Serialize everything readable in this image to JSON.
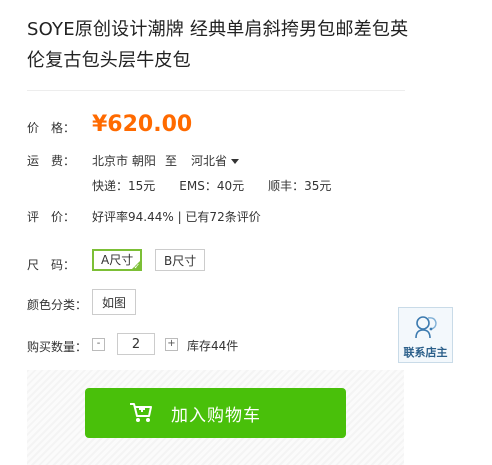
{
  "product": {
    "title": "SOYE原创设计潮牌 经典单肩斜挎男包邮差包英伦复古包头层牛皮包"
  },
  "price": {
    "label": "价　格：",
    "value": "¥620.00"
  },
  "shipping": {
    "label": "运　费：",
    "from": "北京市 朝阳",
    "to_word": "至",
    "to": "河北省",
    "rates": "快递：15元　　EMS：40元　　顺丰：35元"
  },
  "rating": {
    "label": "评　价：",
    "text": "好评率94.44% | 已有72条评价"
  },
  "size": {
    "label": "尺　码：",
    "options": [
      "A尺寸",
      "B尺寸"
    ],
    "selected": "A尺寸"
  },
  "color": {
    "label": "颜色分类：",
    "options": [
      "如图"
    ]
  },
  "quantity": {
    "label": "购买数量：",
    "minus": "-",
    "value": "2",
    "plus": "+",
    "stock": "库存44件"
  },
  "cart": {
    "button_label": "加入购物车",
    "icon": "cart-icon"
  },
  "contact": {
    "label": "联系店主",
    "icon": "customer-service-icon"
  },
  "colors": {
    "price": "#ff6a00",
    "accent_green": "#49c00a",
    "selected_border": "#7cbf36",
    "contact_text": "#2b5f8a"
  }
}
